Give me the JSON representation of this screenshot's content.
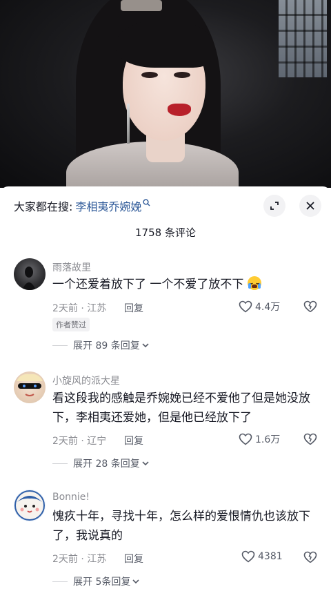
{
  "search": {
    "prefix": "大家都在搜:",
    "term": "李相夷乔婉娩"
  },
  "comment_count": "1758 条评论",
  "comments": [
    {
      "username": "雨落故里",
      "text": "一个还爱着放下了 一个不爱了放不下",
      "time_location": "2天前 · 江苏",
      "reply_label": "回复",
      "likes": "4.4万",
      "badge": "作者赞过",
      "expand_label": "展开 89 条回复"
    },
    {
      "username": "小旋风的派大星",
      "text": "看这段我的感触是乔婉娩已经不爱他了但是她没放下，李相夷还爱她，但是他已经放下了",
      "time_location": "2天前 · 辽宁",
      "reply_label": "回复",
      "likes": "1.6万",
      "expand_label": "展开 28 条回复"
    },
    {
      "username": "Bonnie!",
      "text": "愧疚十年，寻找十年，怎么样的爱恨情仇也该放下了，我说真的",
      "time_location": "2天前 · 江苏",
      "reply_label": "回复",
      "likes": "4381",
      "expand_label": "展开 5条回复"
    }
  ],
  "colors": {
    "search_term": "#2b5797",
    "secondary_text": "#8a8b91",
    "primary_text": "#161823"
  }
}
